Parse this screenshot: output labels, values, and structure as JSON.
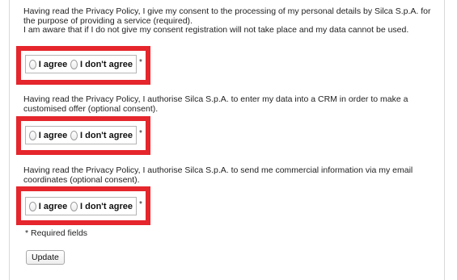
{
  "consents": [
    {
      "text_lines": [
        "Having read the Privacy Policy, I give my consent to the processing of my personal details by Silca S.p.A. for the purpose of providing a service (required).",
        "I am aware that if I do not give my consent registration will not take place and my data cannot be used."
      ],
      "options": [
        "I agree",
        "I don't agree"
      ],
      "asterisk": "*"
    },
    {
      "text_lines": [
        "Having read the Privacy Policy, I authorise Silca S.p.A. to enter my data into a CRM in order to make a customised offer (optional consent)."
      ],
      "options": [
        "I agree",
        "I don't agree"
      ],
      "asterisk": "*"
    },
    {
      "text_lines": [
        "Having read the Privacy Policy, I authorise Silca S.p.A. to send me commercial information via my email coordinates (optional consent)."
      ],
      "options": [
        "I agree",
        "I don't agree"
      ],
      "asterisk": "*"
    }
  ],
  "required_note": "* Required fields",
  "update_label": "Update",
  "colors": {
    "highlight": "#e5262c",
    "text": "#222222",
    "border": "#b5b5b5"
  }
}
